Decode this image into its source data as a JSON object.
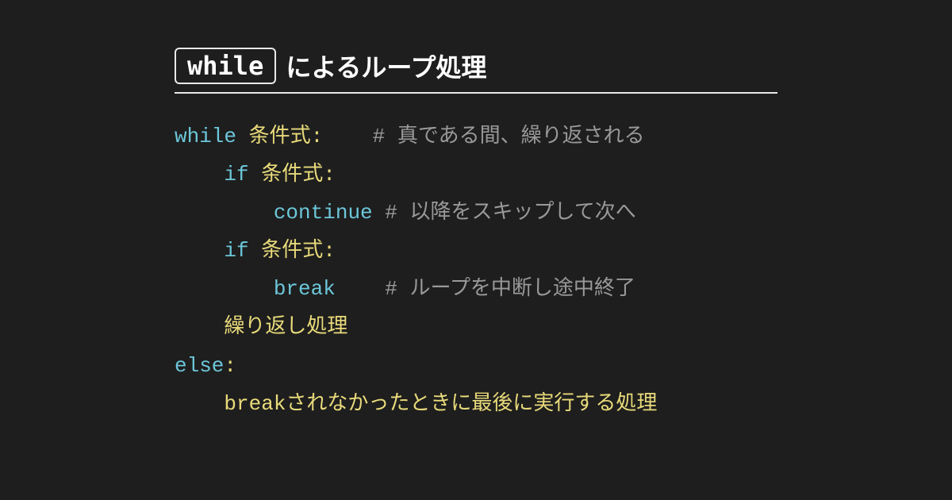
{
  "title": {
    "keyword": "while",
    "text": "によるループ処理"
  },
  "code": {
    "line1": {
      "kw": "while",
      "body": " 条件式:    ",
      "cmt": "# 真である間、繰り返される"
    },
    "line2": {
      "indent": "    ",
      "kw": "if",
      "body": " 条件式:"
    },
    "line3": {
      "indent": "        ",
      "kw": "continue",
      "body": " ",
      "cmt": "# 以降をスキップして次へ"
    },
    "line4": {
      "indent": "    ",
      "kw": "if",
      "body": " 条件式:"
    },
    "line5": {
      "indent": "        ",
      "kw": "break",
      "body": "    ",
      "cmt": "# ループを中断し途中終了"
    },
    "line6": {
      "indent": "    ",
      "body": "繰り返し処理"
    },
    "line7": {
      "kw": "else",
      "body": ":"
    },
    "line8": {
      "indent": "    ",
      "body": "breakされなかったときに最後に実行する処理"
    }
  }
}
